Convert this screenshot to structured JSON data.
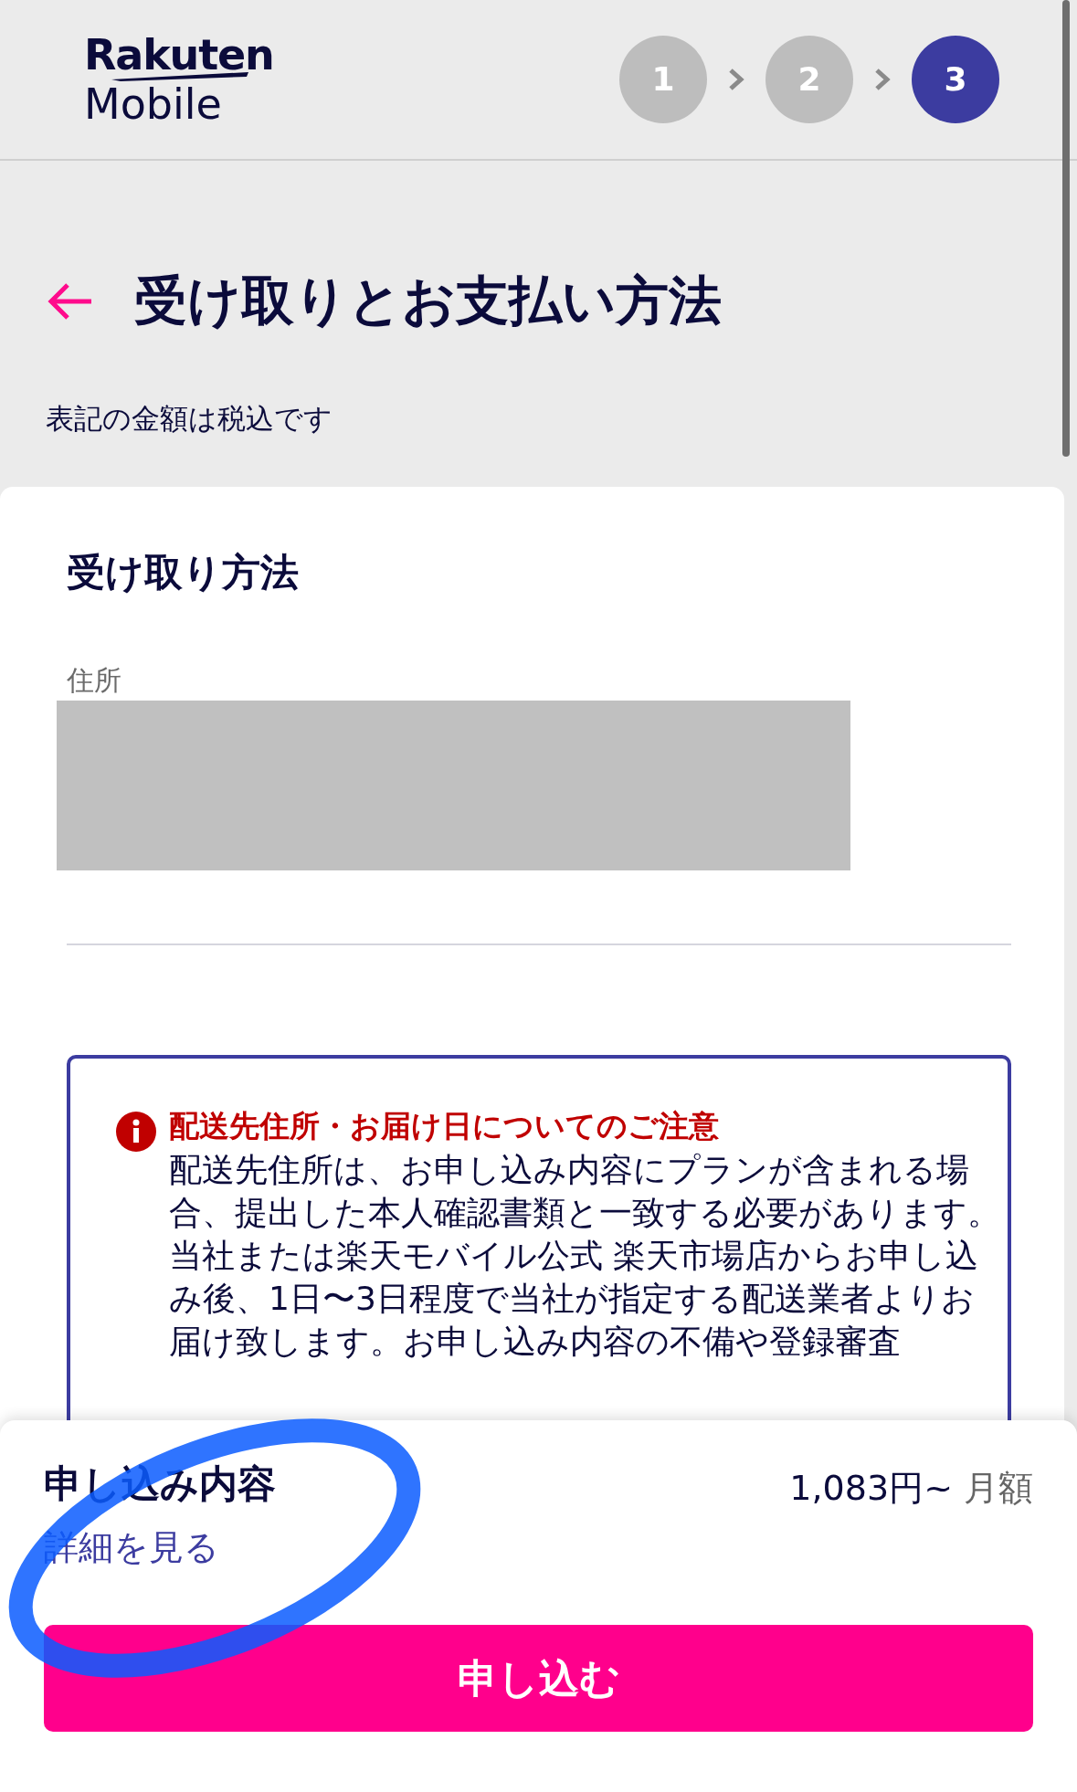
{
  "header": {
    "logo": {
      "top": "Rakuten",
      "bottom": "Mobile"
    },
    "steps": [
      {
        "label": "1",
        "selected": false
      },
      {
        "label": "2",
        "selected": false
      },
      {
        "label": "3",
        "selected": true
      }
    ]
  },
  "page": {
    "title": "受け取りとお支払い方法",
    "tax_note": "表記の金額は税込です"
  },
  "delivery": {
    "heading": "受け取り方法",
    "address_label": "住所",
    "notice": {
      "title": "配送先住所・お届け日についてのご注意",
      "paragraphs": [
        "配送先住所は、お申し込み内容にプランが含まれる場合、提出した本人確認書類と一致する必要があります。",
        "当社または楽天モバイル公式 楽天市場店からお申し込み後、1日〜3日程度で当社が指定する配送業者よりお届け致します。お申し込み内容の不備や登録審査"
      ]
    }
  },
  "summary": {
    "title": "申し込み内容",
    "details_link": "詳細を見る",
    "price": "1,083円~",
    "price_unit": "月額",
    "submit_button": "申し込む"
  }
}
